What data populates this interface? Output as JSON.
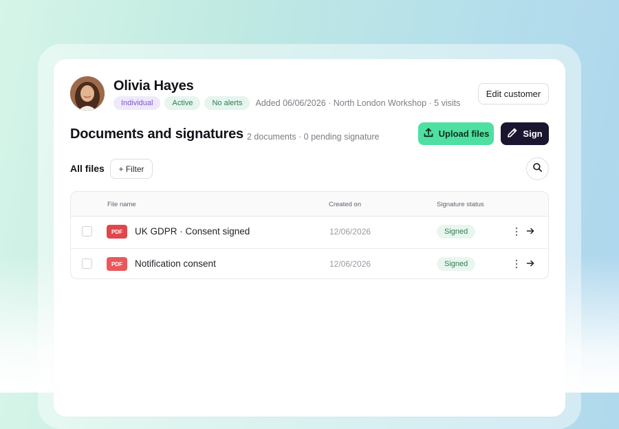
{
  "customer": {
    "name": "Olivia Hayes",
    "badges": [
      "Individual",
      "Active",
      "No alerts"
    ],
    "meta": "Added 06/06/2026 · North London Workshop · 5 visits",
    "edit_label": "Edit customer"
  },
  "documents": {
    "title": "Documents and signatures",
    "subtitle": "2 documents · 0 pending signature",
    "upload_label": "Upload files",
    "sign_label": "Sign"
  },
  "toolbar": {
    "all_files_label": "All files",
    "filter_label": "+ Filter"
  },
  "table": {
    "headers": [
      "File name",
      "Created on",
      "Signature status"
    ],
    "rows": [
      {
        "type": "PDF",
        "name": "UK GDPR · Consent signed",
        "created": "12/06/2026",
        "status": "Signed"
      },
      {
        "type": "PDF",
        "name": "Notification consent",
        "created": "12/06/2026",
        "status": "Signed"
      }
    ]
  },
  "colors": {
    "accent_green": "#4ee0a0",
    "dark_button": "#1c1530",
    "pdf_red": "#e0474c",
    "signed_green": "#2f7a55"
  },
  "icons": [
    "avatar",
    "upload-icon",
    "pen-icon",
    "search-icon",
    "pdf-icon",
    "kebab-icon",
    "arrow-right-icon"
  ]
}
